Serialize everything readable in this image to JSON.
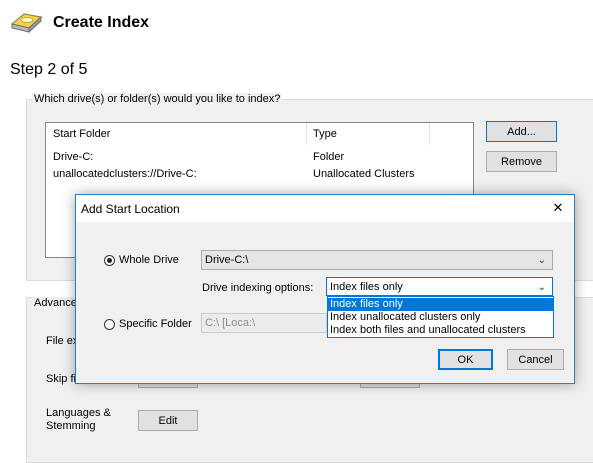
{
  "header": {
    "title": "Create Index",
    "step": "Step 2 of 5"
  },
  "drives_group": {
    "question": "Which drive(s) or folder(s) would you like to index?",
    "columns": [
      "Start Folder",
      "Type"
    ],
    "rows": [
      {
        "folder": "Drive-C:",
        "type": "Folder"
      },
      {
        "folder": "unallocatedclusters://Drive-C:",
        "type": "Unallocated Clusters"
      }
    ],
    "add_label": "Add...",
    "remove_label": "Remove"
  },
  "advanced_group": {
    "caption": "Advance",
    "file_label": "File ex",
    "skip_label": "Skip fi",
    "languages_label_1": "Languages &",
    "languages_label_2": "Stemming",
    "edit_label": "Edit"
  },
  "dialog": {
    "title": "Add Start Location",
    "close_glyph": "✕",
    "whole_drive_label": "Whole Drive",
    "whole_drive_value": "Drive-C:\\",
    "indexing_options_label": "Drive indexing options:",
    "indexing_selected": "Index files only",
    "indexing_options": [
      "Index files only",
      "Index unallocated clusters only",
      "Index both files and unallocated clusters"
    ],
    "specific_folder_label": "Specific Folder",
    "specific_folder_value": "C:\\ [Loca:\\",
    "ok_label": "OK",
    "cancel_label": "Cancel",
    "selected_mode": "whole_drive"
  },
  "icons": {
    "app": "hard-drive-icon",
    "dropdown_arrow": "chevron-down-icon"
  },
  "colors": {
    "accent": "#0078d7",
    "dialog_border": "#1883d7"
  }
}
